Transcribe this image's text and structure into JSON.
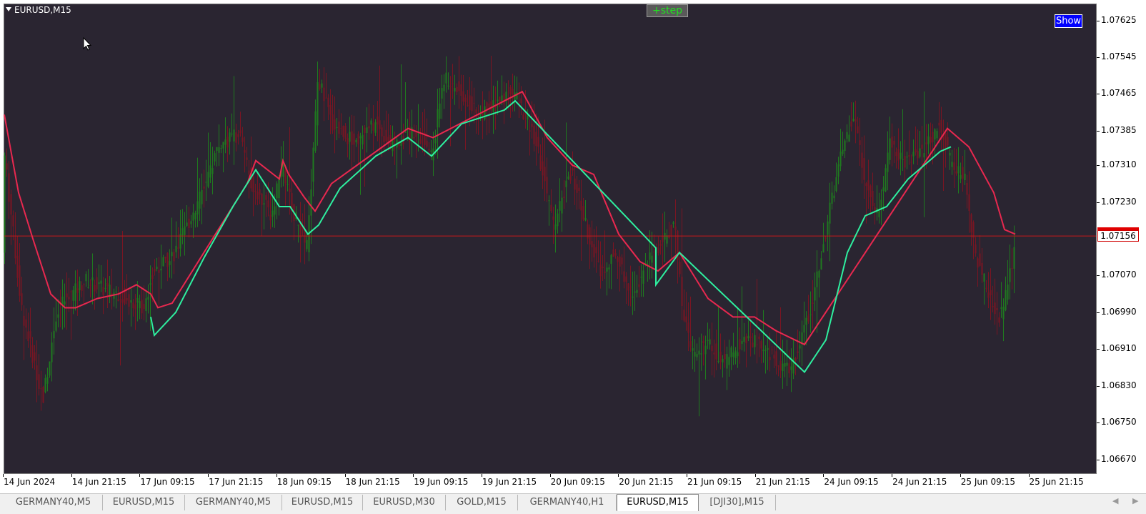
{
  "window": {
    "symbol_title": "EURUSD,M15",
    "step_button_label": "+step",
    "show_button_label": "Show"
  },
  "colors": {
    "background": "#2a2531",
    "bull_candle": "#1f7a1f",
    "bear_candle": "#7a1522",
    "upper_band": "#e8284f",
    "lower_band": "#2ef0a0",
    "price_line": "#c81a1a",
    "step_text": "#21e021",
    "show_button": "#0000ff"
  },
  "price_axis": {
    "labels": [
      "1.07625",
      "1.07545",
      "1.07465",
      "1.07385",
      "1.07310",
      "1.07230",
      "1.07070",
      "1.06990",
      "1.06910",
      "1.06830",
      "1.06750",
      "1.06670"
    ],
    "current_price": "1.07156"
  },
  "time_axis": {
    "labels": [
      "14 Jun 2024",
      "14 Jun 21:15",
      "17 Jun 09:15",
      "17 Jun 21:15",
      "18 Jun 09:15",
      "18 Jun 21:15",
      "19 Jun 09:15",
      "19 Jun 21:15",
      "20 Jun 09:15",
      "20 Jun 21:15",
      "21 Jun 09:15",
      "21 Jun 21:15",
      "24 Jun 09:15",
      "24 Jun 21:15",
      "25 Jun 09:15",
      "25 Jun 21:15"
    ]
  },
  "tabs": [
    {
      "label": "GERMANY40,M5",
      "active": false
    },
    {
      "label": "EURUSD,M15",
      "active": false
    },
    {
      "label": "GERMANY40,M5",
      "active": false
    },
    {
      "label": "EURUSD,M15",
      "active": false
    },
    {
      "label": "EURUSD,M30",
      "active": false
    },
    {
      "label": "GOLD,M15",
      "active": false
    },
    {
      "label": "GERMANY40,H1",
      "active": false
    },
    {
      "label": "EURUSD,M15",
      "active": true
    },
    {
      "label": "[DJI30],M15",
      "active": false
    }
  ],
  "chart_data": {
    "type": "candlestick",
    "ylim": [
      1.0664,
      1.0766
    ],
    "current_price": 1.07156,
    "close_path": [
      [
        0,
        1.0735
      ],
      [
        25,
        1.07
      ],
      [
        55,
        1.068
      ],
      [
        75,
        1.07
      ],
      [
        90,
        1.0702
      ],
      [
        115,
        1.0706
      ],
      [
        140,
        1.0704
      ],
      [
        165,
        1.0703
      ],
      [
        195,
        1.07
      ],
      [
        210,
        1.0708
      ],
      [
        240,
        1.0712
      ],
      [
        275,
        1.0724
      ],
      [
        300,
        1.0735
      ],
      [
        330,
        1.0738
      ],
      [
        345,
        1.0728
      ],
      [
        375,
        1.072
      ],
      [
        390,
        1.0731
      ],
      [
        405,
        1.0721
      ],
      [
        425,
        1.0713
      ],
      [
        440,
        1.075
      ],
      [
        460,
        1.074
      ],
      [
        490,
        1.0736
      ],
      [
        520,
        1.074
      ],
      [
        545,
        1.0735
      ],
      [
        565,
        1.0738
      ],
      [
        585,
        1.0737
      ],
      [
        600,
        1.0733
      ],
      [
        615,
        1.075
      ],
      [
        640,
        1.0747
      ],
      [
        665,
        1.0742
      ],
      [
        690,
        1.0745
      ],
      [
        715,
        1.0747
      ],
      [
        745,
        1.0736
      ],
      [
        770,
        1.0718
      ],
      [
        795,
        1.073
      ],
      [
        815,
        1.0718
      ],
      [
        835,
        1.0708
      ],
      [
        855,
        1.0712
      ],
      [
        880,
        1.0703
      ],
      [
        910,
        1.0712
      ],
      [
        940,
        1.0718
      ],
      [
        950,
        1.07
      ],
      [
        965,
        1.069
      ],
      [
        985,
        1.0692
      ],
      [
        1010,
        1.0688
      ],
      [
        1040,
        1.0694
      ],
      [
        1070,
        1.069
      ],
      [
        1100,
        1.0686
      ],
      [
        1130,
        1.07
      ],
      [
        1155,
        1.072
      ],
      [
        1175,
        1.0735
      ],
      [
        1190,
        1.0742
      ],
      [
        1205,
        1.0728
      ],
      [
        1225,
        1.072
      ],
      [
        1240,
        1.0736
      ],
      [
        1260,
        1.0732
      ],
      [
        1285,
        1.0734
      ],
      [
        1310,
        1.074
      ],
      [
        1325,
        1.0732
      ],
      [
        1345,
        1.0728
      ],
      [
        1360,
        1.0712
      ],
      [
        1380,
        1.0702
      ],
      [
        1395,
        1.0698
      ],
      [
        1415,
        1.0712
      ]
    ],
    "upper_band": [
      [
        0,
        1.0742
      ],
      [
        20,
        1.0725
      ],
      [
        40,
        1.0715
      ],
      [
        65,
        1.0703
      ],
      [
        85,
        1.07
      ],
      [
        100,
        1.07
      ],
      [
        130,
        1.0702
      ],
      [
        160,
        1.0703
      ],
      [
        185,
        1.0705
      ],
      [
        205,
        1.0703
      ],
      [
        215,
        1.07
      ],
      [
        235,
        1.0701
      ],
      [
        340,
        1.0727
      ],
      [
        352,
        1.0732
      ],
      [
        385,
        1.0728
      ],
      [
        390,
        1.0732
      ],
      [
        398,
        1.0729
      ],
      [
        420,
        1.0724
      ],
      [
        435,
        1.0721
      ],
      [
        458,
        1.0727
      ],
      [
        565,
        1.0739
      ],
      [
        600,
        1.0737
      ],
      [
        725,
        1.0747
      ],
      [
        760,
        1.0737
      ],
      [
        795,
        1.0731
      ],
      [
        825,
        1.0729
      ],
      [
        860,
        1.0716
      ],
      [
        890,
        1.071
      ],
      [
        915,
        1.0708
      ],
      [
        945,
        1.0712
      ],
      [
        985,
        1.0702
      ],
      [
        1020,
        1.0698
      ],
      [
        1050,
        1.0698
      ],
      [
        1080,
        1.0695
      ],
      [
        1120,
        1.0692
      ],
      [
        1320,
        1.0739
      ],
      [
        1350,
        1.0735
      ],
      [
        1385,
        1.0725
      ],
      [
        1400,
        1.0717
      ],
      [
        1415,
        1.0716
      ]
    ],
    "lower_band": [
      [
        205,
        1.0698
      ],
      [
        210,
        1.0694
      ],
      [
        240,
        1.0699
      ],
      [
        280,
        1.0711
      ],
      [
        320,
        1.0722
      ],
      [
        352,
        1.073
      ],
      [
        385,
        1.0722
      ],
      [
        400,
        1.0722
      ],
      [
        425,
        1.0716
      ],
      [
        440,
        1.0718
      ],
      [
        470,
        1.0726
      ],
      [
        520,
        1.0733
      ],
      [
        565,
        1.0737
      ],
      [
        598,
        1.0733
      ],
      [
        640,
        1.074
      ],
      [
        700,
        1.0743
      ],
      [
        715,
        1.0745
      ],
      [
        912,
        1.0713
      ],
      [
        912,
        1.0705
      ],
      [
        945,
        1.0712
      ],
      [
        1120,
        1.0686
      ],
      [
        1150,
        1.0693
      ],
      [
        1180,
        1.0712
      ],
      [
        1205,
        1.072
      ],
      [
        1235,
        1.0722
      ],
      [
        1265,
        1.0728
      ],
      [
        1310,
        1.0734
      ],
      [
        1325,
        1.0735
      ]
    ]
  }
}
